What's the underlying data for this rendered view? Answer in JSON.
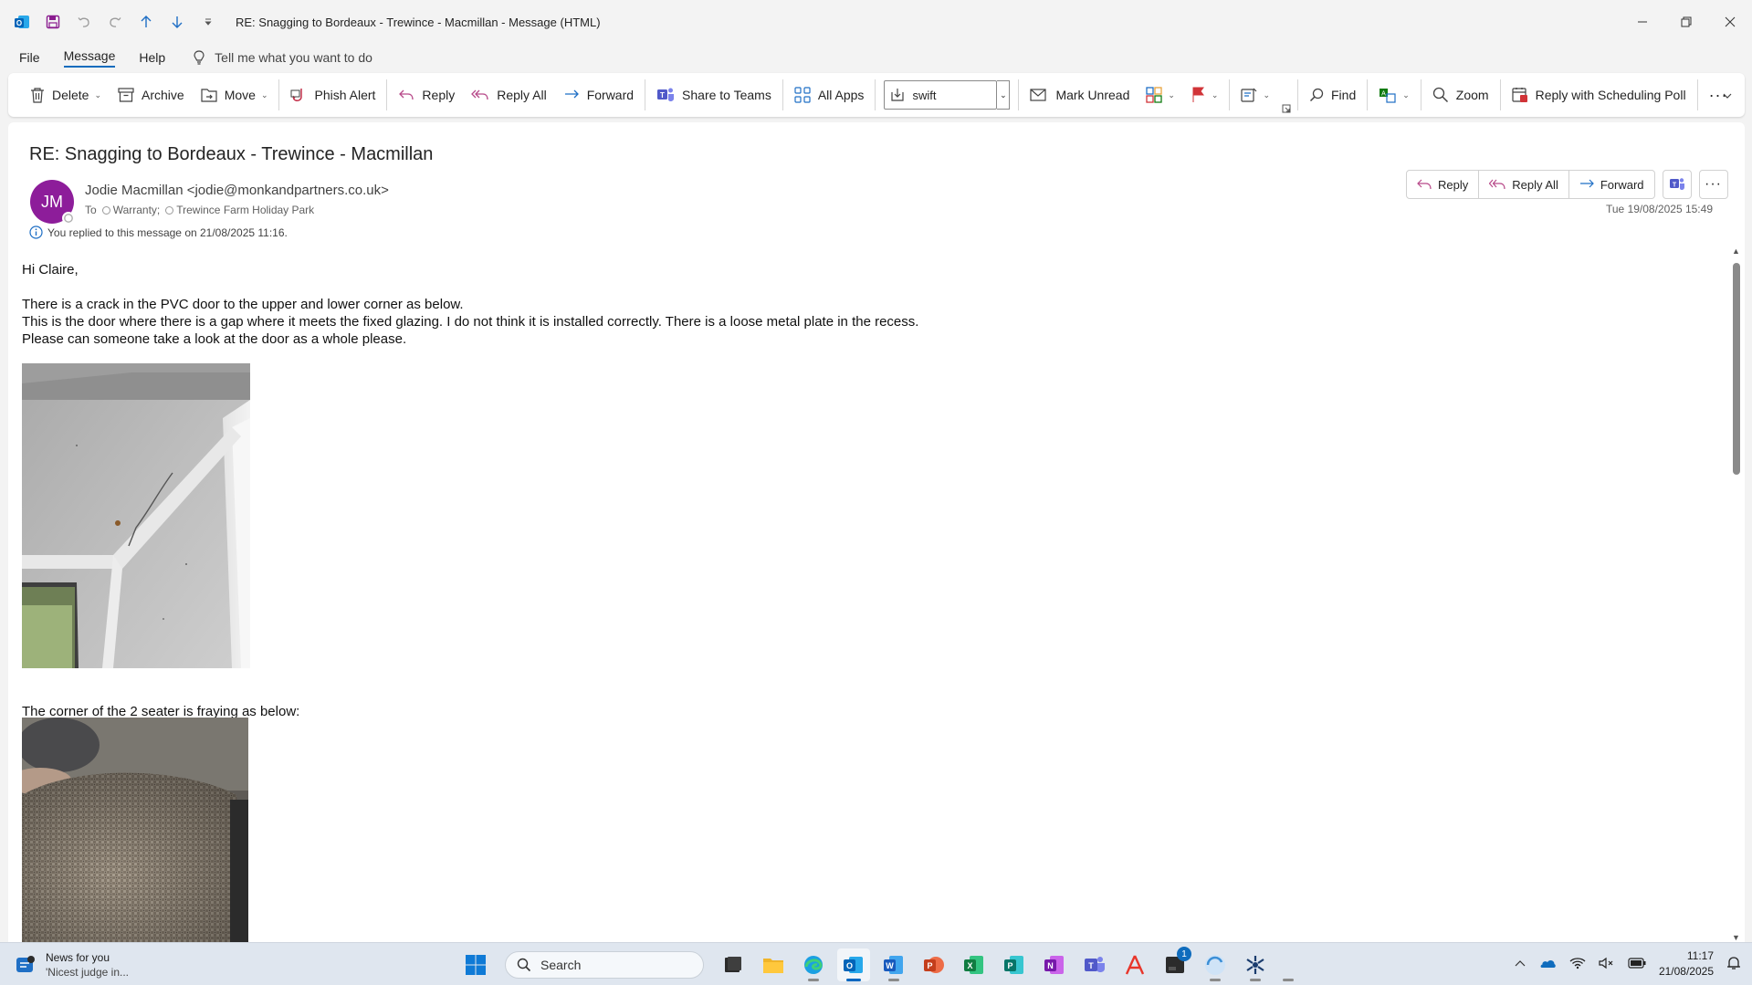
{
  "window": {
    "title": "RE: Snagging to Bordeaux - Trewince - Macmillan  -  Message (HTML)"
  },
  "menu": {
    "file": "File",
    "message": "Message",
    "help": "Help",
    "tell_me": "Tell me what you want to do"
  },
  "ribbon": {
    "delete": "Delete",
    "archive": "Archive",
    "move": "Move",
    "phish_alert": "Phish Alert",
    "reply": "Reply",
    "reply_all": "Reply All",
    "forward": "Forward",
    "share_to_teams": "Share to Teams",
    "all_apps": "All Apps",
    "quick_step_value": "swift",
    "mark_unread": "Mark Unread",
    "find": "Find",
    "zoom": "Zoom",
    "reply_with_poll": "Reply with Scheduling Poll"
  },
  "message": {
    "subject": "RE: Snagging to Bordeaux - Trewince - Macmillan",
    "avatar_initials": "JM",
    "from": "Jodie Macmillan <jodie@monkandpartners.co.uk>",
    "to_label": "To",
    "recipients": [
      "Warranty;",
      "Trewince Farm Holiday Park"
    ],
    "replied_note": "You replied to this message on 21/08/2025 11:16.",
    "date": "Tue 19/08/2025 15:49",
    "actions": {
      "reply": "Reply",
      "reply_all": "Reply All",
      "forward": "Forward"
    },
    "body": {
      "greeting": "Hi Claire,",
      "line1": "There is a crack in the PVC door to the upper and lower corner as below.",
      "line2": "This is the door where there is a gap where it meets the fixed glazing. I do not think it is installed correctly. There is a loose metal plate in the recess.",
      "line3": "Please can someone take a look at the door as a whole please.",
      "line4": "The corner of the 2 seater is fraying as below:"
    }
  },
  "taskbar": {
    "news_title": "News for you",
    "news_sub": "'Nicest judge in...",
    "search": "Search",
    "teams_badge": "1",
    "time": "11:17",
    "date": "21/08/2025"
  }
}
